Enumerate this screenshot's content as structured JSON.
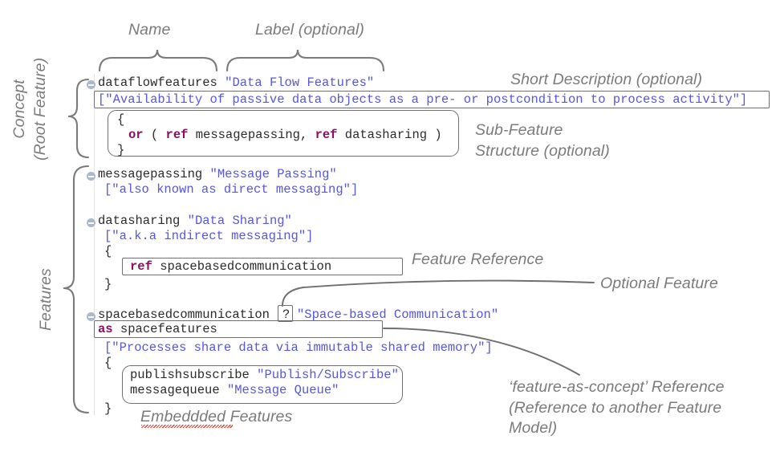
{
  "annotations": {
    "name": "Name",
    "label": "Label (optional)",
    "short_description": "Short Description (optional)",
    "sub_feature_structure": "Sub-Feature\nStructure (optional)",
    "feature_reference": "Feature Reference",
    "optional_feature": "Optional Feature",
    "feature_as_concept": "‘feature-as-concept’ Reference\n(Reference to another Feature\nModel)",
    "embedded_features": "Embeddded Features",
    "concept_root_feature": "Concept\n(Root Feature)",
    "features": "Features"
  },
  "colors": {
    "string": "#5656df",
    "keyword": "#8b1062",
    "identifier": "#2b2b2b",
    "annotation": "#7b7b7b",
    "box_border": "#6f6f6f",
    "fold_icon": "#aab9cc",
    "spellcheck": "#e23b2e",
    "background": "#ffffff"
  },
  "code": {
    "concept_block": {
      "name": "dataflowfeatures",
      "label": "\"Data Flow Features\"",
      "description": "[\"Availability of passive data objects as a pre- or postcondition to process activity\"]",
      "brace_open": "{",
      "structure_keyword": "or",
      "structure_body_open": " ( ",
      "ref_keyword_1": "ref",
      "ref_target_1": " messagepassing, ",
      "ref_keyword_2": "ref",
      "ref_target_2": " datasharing )",
      "brace_close": "}"
    },
    "features": [
      {
        "name": "messagepassing",
        "label": "\"Message Passing\"",
        "description": "[\"also known as direct messaging\"]"
      },
      {
        "name": "datasharing",
        "label": "\"Data Sharing\"",
        "description": "[\"a.k.a indirect messaging\"]",
        "brace_open": "{",
        "ref_keyword": "ref",
        "ref_target": " spacebasedcommunication",
        "brace_close": "}"
      },
      {
        "name": "spacebasedcommunication",
        "optional_marker": "?",
        "label": "\"Space-based Communication\"",
        "as_keyword": "as",
        "as_target": " spacefeatures",
        "description": "[\"Processes share data via immutable shared memory\"]",
        "brace_open": "{",
        "children": [
          {
            "name": "publishsubscribe",
            "label": "\"Publish/Subscribe\""
          },
          {
            "name": "messagequeue",
            "label": "\"Message Queue\""
          }
        ],
        "brace_close": "}"
      }
    ]
  }
}
